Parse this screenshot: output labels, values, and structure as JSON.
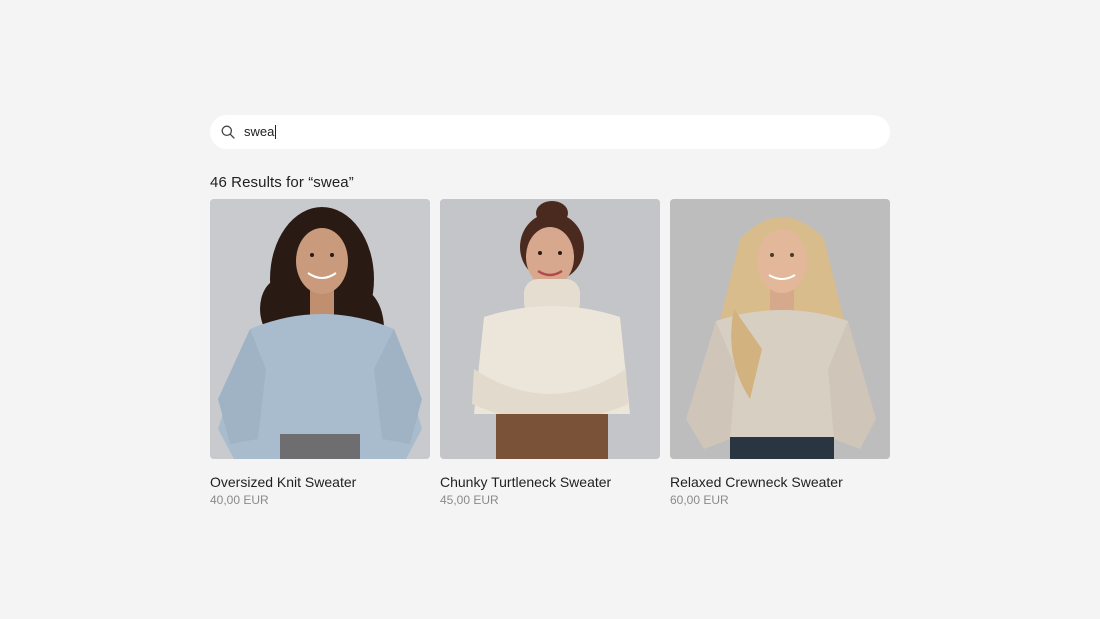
{
  "search": {
    "value": "swea",
    "icon": "search-icon"
  },
  "results": {
    "heading": "46 Results for “swea”"
  },
  "products": [
    {
      "name": "Oversized Knit Sweater",
      "price": "40,00 EUR",
      "image": "model-in-light-blue-sweater",
      "colors": {
        "background": "#c9cacd",
        "garment": "#a9bccd",
        "hair": "#2a1a14",
        "skin": "#c99a7c",
        "pants": "#6e6e70"
      }
    },
    {
      "name": "Chunky Turtleneck Sweater",
      "price": "45,00 EUR",
      "image": "model-in-cream-turtleneck",
      "colors": {
        "background": "#c4c5c9",
        "garment": "#ece6da",
        "hair": "#4a2a1e",
        "skin": "#d8a88e",
        "pants": "#7a5238"
      }
    },
    {
      "name": "Relaxed Crewneck Sweater",
      "price": "60,00 EUR",
      "image": "model-in-beige-crewneck",
      "colors": {
        "background": "#bdbdbe",
        "garment": "#d8cfc3",
        "hair": "#d9bc8c",
        "skin": "#e2b79a",
        "pants": "#2a3542"
      }
    }
  ]
}
